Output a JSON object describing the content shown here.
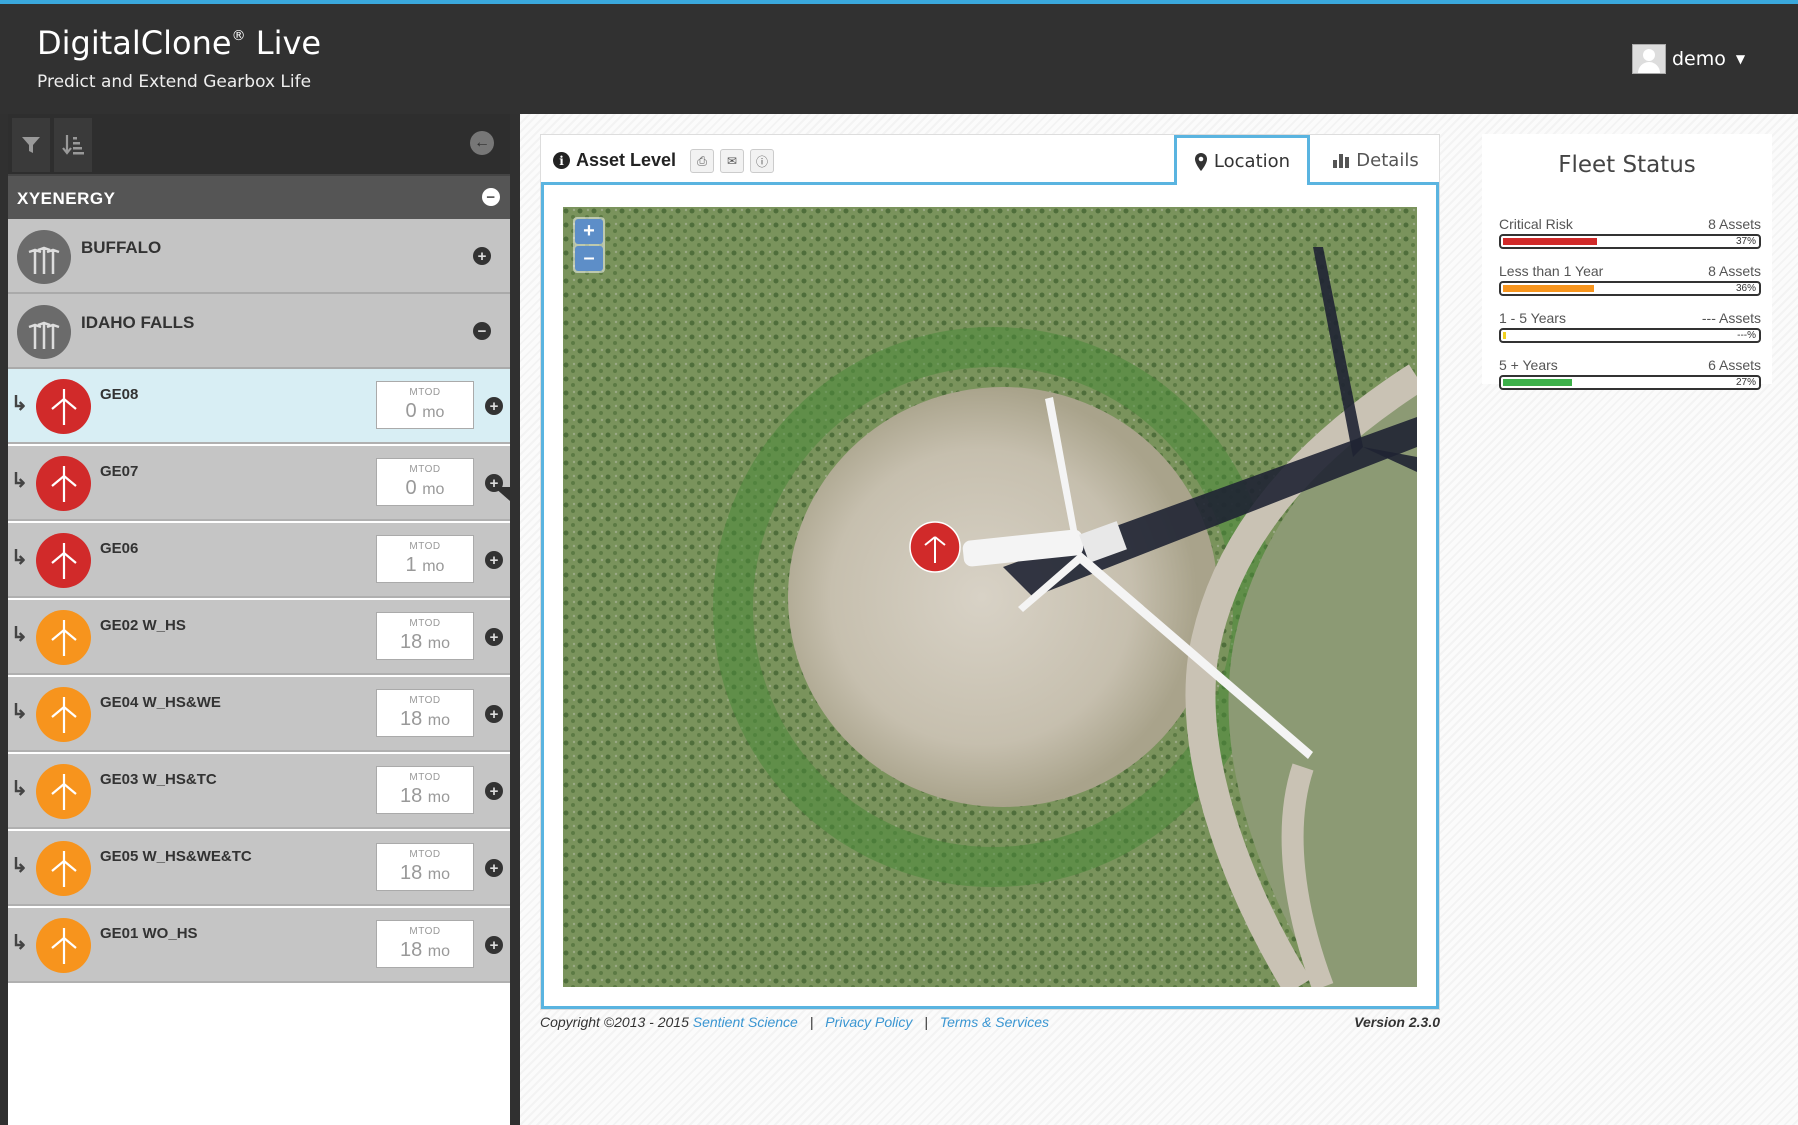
{
  "header": {
    "title": "DigitalClone",
    "title_reg": "®",
    "title_suffix": "Live",
    "subtitle": "Predict and Extend Gearbox Life",
    "user": "demo"
  },
  "sidebar": {
    "company": "XYENERGY",
    "sites": [
      {
        "name": "BUFFALO",
        "expanded": false
      },
      {
        "name": "IDAHO FALLS",
        "expanded": true
      }
    ],
    "mtod_label": "MTOD",
    "assets": [
      {
        "name": "GE08",
        "mtod": "0",
        "unit": "mo",
        "status": "critical",
        "selected": true
      },
      {
        "name": "GE07",
        "mtod": "0",
        "unit": "mo",
        "status": "critical"
      },
      {
        "name": "GE06",
        "mtod": "1",
        "unit": "mo",
        "status": "critical"
      },
      {
        "name": "GE02 W_HS",
        "mtod": "18",
        "unit": "mo",
        "status": "warning"
      },
      {
        "name": "GE04 W_HS&WE",
        "mtod": "18",
        "unit": "mo",
        "status": "warning"
      },
      {
        "name": "GE03 W_HS&TC",
        "mtod": "18",
        "unit": "mo",
        "status": "warning"
      },
      {
        "name": "GE05 W_HS&WE&TC",
        "mtod": "18",
        "unit": "mo",
        "status": "warning"
      },
      {
        "name": "GE01 WO_HS",
        "mtod": "18",
        "unit": "mo",
        "status": "warning"
      }
    ]
  },
  "panel": {
    "title": "Asset Level",
    "tabs": [
      {
        "label": "Location",
        "active": true,
        "icon": "map-pin-icon"
      },
      {
        "label": "Details",
        "active": false,
        "icon": "bar-chart-icon"
      }
    ],
    "zoom_in": "+",
    "zoom_out": "–"
  },
  "footer": {
    "copyright": "Copyright ©2013 - 2015",
    "company_link": "Sentient Science",
    "privacy": "Privacy Policy",
    "terms": "Terms & Services",
    "version": "Version 2.3.0",
    "separator": "|"
  },
  "fleet_status": {
    "title": "Fleet Status",
    "rows": [
      {
        "label": "Critical Risk",
        "count": "8 Assets",
        "pct": "37%",
        "fill": 0.37,
        "color": "#d12a2a"
      },
      {
        "label": "Less than 1 Year",
        "count": "8 Assets",
        "pct": "36%",
        "fill": 0.36,
        "color": "#f7941d"
      },
      {
        "label": "1 - 5 Years",
        "count": "--- Assets",
        "pct": "---%",
        "fill": 0.01,
        "color": "#f0d020"
      },
      {
        "label": "5 + Years",
        "count": "6 Assets",
        "pct": "27%",
        "fill": 0.27,
        "color": "#3db04a"
      }
    ]
  },
  "colors": {
    "accent": "#5ab4e0",
    "critical": "#d12a2a",
    "warning": "#f7941d",
    "good": "#3db04a"
  }
}
